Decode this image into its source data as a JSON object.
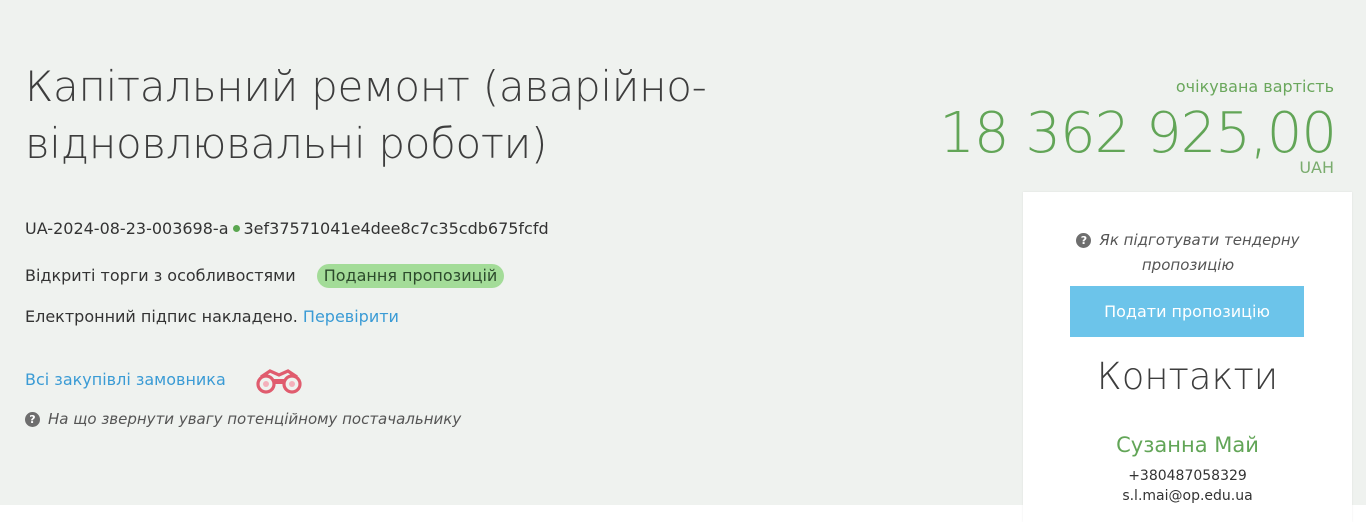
{
  "tender": {
    "title": "Капітальний ремонт (аварійно-відновлювальні роботи)",
    "tender_id": "UA-2024-08-23-003698-a",
    "hash": "3ef37571041e4dee8c7c35cdb675fcfd",
    "procedure_type": "Відкриті торги з особливостями",
    "status": "Подання пропозицій",
    "signature_text": "Електронний підпис накладено.",
    "signature_check_link": "Перевірити",
    "all_purchases_link": "Всі закупівлі замовника",
    "supplier_hint": "На що звернути увагу потенційному постачальнику"
  },
  "value": {
    "label": "очікувана вартість",
    "amount": "18 362 925,00",
    "currency": "UAH"
  },
  "sidebar": {
    "hint": "Як підготувати тендерну пропозицію",
    "submit_button": "Подати пропозицію",
    "contacts_title": "Контакти",
    "contact_name": "Сузанна Май",
    "contact_phone": "+380487058329",
    "contact_email": "s.l.mai@op.edu.ua"
  },
  "colors": {
    "page_background": "#eff2ef",
    "accent_green": "#62a557",
    "status_badge": "#a3dc98",
    "link_blue": "#3a9bd5",
    "button_blue": "#6cc4ea",
    "binoculars_icon": "#e05c6e"
  },
  "icons": {
    "binoculars": "binoculars-icon",
    "question": "question-circle-icon",
    "status_dot": "dot-icon"
  }
}
